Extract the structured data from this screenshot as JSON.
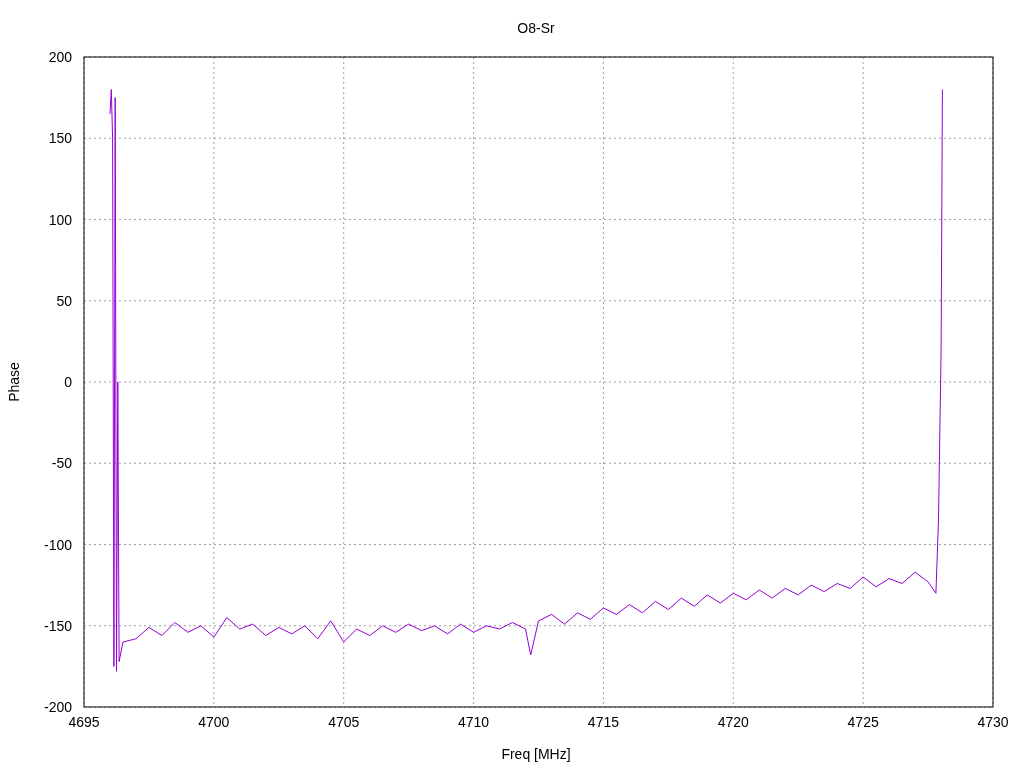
{
  "chart_data": {
    "type": "line",
    "title": "O8-Sr",
    "xlabel": "Freq [MHz]",
    "ylabel": "Phase",
    "grid": true,
    "xlim": [
      4695,
      4730
    ],
    "ylim": [
      -200,
      200
    ],
    "xticks": [
      4695,
      4700,
      4705,
      4710,
      4715,
      4720,
      4725,
      4730
    ],
    "yticks": [
      -200,
      -150,
      -100,
      -50,
      0,
      50,
      100,
      150,
      200
    ],
    "x": [
      4696.0,
      4696.05,
      4696.1,
      4696.15,
      4696.2,
      4696.25,
      4696.3,
      4696.35,
      4696.5,
      4697,
      4697.5,
      4698,
      4698.5,
      4699,
      4699.5,
      4700,
      4700.5,
      4701,
      4701.5,
      4702,
      4702.5,
      4703,
      4703.5,
      4704,
      4704.5,
      4705,
      4705.5,
      4706,
      4706.5,
      4707,
      4707.5,
      4708,
      4708.5,
      4709,
      4709.5,
      4710,
      4710.5,
      4711,
      4711.5,
      4712,
      4712.2,
      4712.5,
      4713,
      4713.5,
      4714,
      4714.5,
      4715,
      4715.5,
      4716,
      4716.5,
      4717,
      4717.5,
      4718,
      4718.5,
      4719,
      4719.5,
      4720,
      4720.5,
      4721,
      4721.5,
      4722,
      4722.5,
      4723,
      4723.5,
      4724,
      4724.5,
      4725,
      4725.5,
      4726,
      4726.5,
      4727,
      4727.5,
      4727.8,
      4727.9,
      4728,
      4728.05
    ],
    "series": [
      {
        "color": "#9400d3",
        "values": [
          165,
          180,
          150,
          -175,
          175,
          -178,
          0,
          -172,
          -160,
          -158,
          -151,
          -156,
          -148,
          -154,
          -150,
          -157,
          -145,
          -152,
          -149,
          -156,
          -151,
          -155,
          -150,
          -158,
          -147,
          -160,
          -152,
          -156,
          -150,
          -154,
          -149,
          -153,
          -150,
          -155,
          -149,
          -154,
          -150,
          -152,
          -148,
          -152,
          -168,
          -147,
          -143,
          -149,
          -142,
          -146,
          -139,
          -143,
          -137,
          -142,
          -135,
          -140,
          -133,
          -138,
          -131,
          -136,
          -130,
          -134,
          -128,
          -133,
          -127,
          -131,
          -125,
          -129,
          -124,
          -127,
          -120,
          -126,
          -121,
          -124,
          -117,
          -123,
          -130,
          -85,
          20,
          180
        ]
      }
    ]
  }
}
